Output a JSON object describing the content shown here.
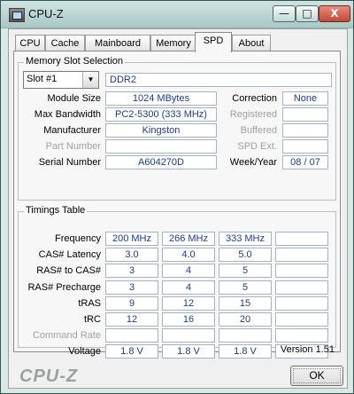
{
  "window": {
    "title": "CPU-Z",
    "minimize": "—",
    "maximize": "□",
    "close": "X"
  },
  "tabs": [
    {
      "label": "CPU"
    },
    {
      "label": "Cache"
    },
    {
      "label": "Mainboard"
    },
    {
      "label": "Memory"
    },
    {
      "label": "SPD",
      "active": true
    },
    {
      "label": "About"
    }
  ],
  "memory_slot": {
    "group_label": "Memory Slot Selection",
    "slot_selected": "Slot #1",
    "memory_type": "DDR2",
    "module_size_label": "Module Size",
    "module_size": "1024 MBytes",
    "max_bandwidth_label": "Max Bandwidth",
    "max_bandwidth": "PC2-5300 (333 MHz)",
    "manufacturer_label": "Manufacturer",
    "manufacturer": "Kingston",
    "part_number_label": "Part Number",
    "part_number": "",
    "serial_number_label": "Serial Number",
    "serial_number": "A604270D",
    "correction_label": "Correction",
    "correction": "None",
    "registered_label": "Registered",
    "registered": "",
    "buffered_label": "Buffered",
    "buffered": "",
    "spd_ext_label": "SPD Ext.",
    "spd_ext": "",
    "week_year_label": "Week/Year",
    "week_year": "08 / 07"
  },
  "timings": {
    "group_label": "Timings Table",
    "rows": [
      {
        "label": "Frequency",
        "values": [
          "200 MHz",
          "266 MHz",
          "333 MHz",
          ""
        ],
        "disabled": false
      },
      {
        "label": "CAS# Latency",
        "values": [
          "3.0",
          "4.0",
          "5.0",
          ""
        ],
        "disabled": false
      },
      {
        "label": "RAS# to CAS#",
        "values": [
          "3",
          "4",
          "5",
          ""
        ],
        "disabled": false
      },
      {
        "label": "RAS# Precharge",
        "values": [
          "3",
          "4",
          "5",
          ""
        ],
        "disabled": false
      },
      {
        "label": "tRAS",
        "values": [
          "9",
          "12",
          "15",
          ""
        ],
        "disabled": false
      },
      {
        "label": "tRC",
        "values": [
          "12",
          "16",
          "20",
          ""
        ],
        "disabled": false
      },
      {
        "label": "Command Rate",
        "values": [
          "",
          "",
          "",
          ""
        ],
        "disabled": true
      },
      {
        "label": "Voltage",
        "values": [
          "1.8 V",
          "1.8 V",
          "1.8 V",
          ""
        ],
        "disabled": false
      }
    ]
  },
  "footer": {
    "version": "Version 1.51",
    "brand": "CPU-Z",
    "ok_label": "OK"
  }
}
